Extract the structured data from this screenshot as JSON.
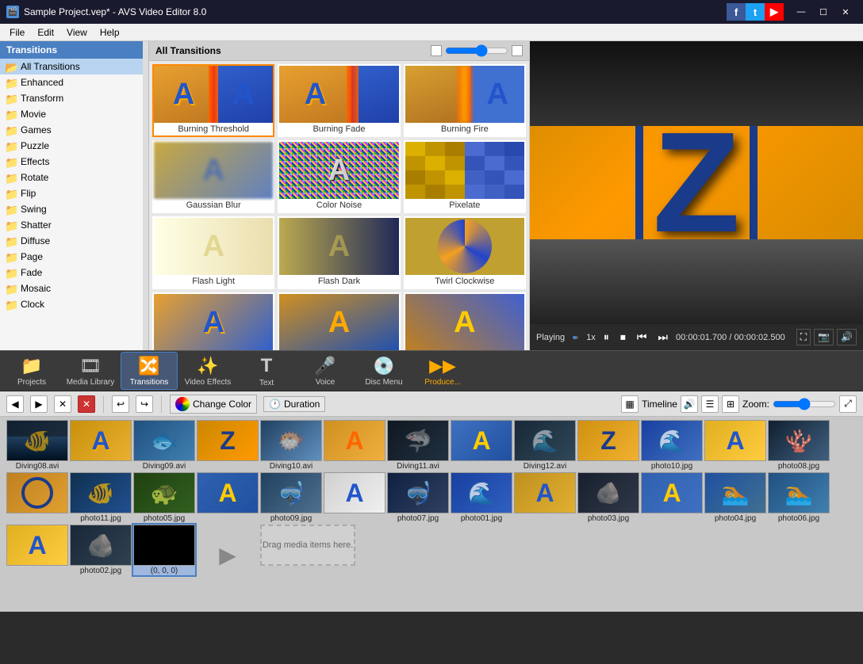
{
  "titleBar": {
    "title": "Sample Project.vep* - AVS Video Editor 8.0",
    "appIcon": "🎬",
    "controls": [
      "—",
      "☐",
      "✕"
    ]
  },
  "menuBar": {
    "items": [
      "File",
      "Edit",
      "View",
      "Help"
    ]
  },
  "transitionsPanel": {
    "header": "Transitions",
    "items": [
      {
        "label": "All Transitions",
        "active": true
      },
      {
        "label": "Enhanced"
      },
      {
        "label": "Transform"
      },
      {
        "label": "Movie"
      },
      {
        "label": "Games"
      },
      {
        "label": "Puzzle"
      },
      {
        "label": "Effects"
      },
      {
        "label": "Rotate"
      },
      {
        "label": "Flip"
      },
      {
        "label": "Swing"
      },
      {
        "label": "Shatter"
      },
      {
        "label": "Diffuse"
      },
      {
        "label": "Page"
      },
      {
        "label": "Fade"
      },
      {
        "label": "Mosaic"
      },
      {
        "label": "Clock"
      }
    ]
  },
  "gridPanel": {
    "header": "All Transitions",
    "thumbnails": [
      {
        "label": "Burning Threshold",
        "type": "burning-threshold"
      },
      {
        "label": "Burning Fade",
        "type": "burning-fade"
      },
      {
        "label": "Burning Fire",
        "type": "burning-fire"
      },
      {
        "label": "Gaussian Blur",
        "type": "gaussian-blur"
      },
      {
        "label": "Color Noise",
        "type": "color-noise"
      },
      {
        "label": "Pixelate",
        "type": "pixelate"
      },
      {
        "label": "Flash Light",
        "type": "flash-light"
      },
      {
        "label": "Flash Dark",
        "type": "flash-dark"
      },
      {
        "label": "Twirl Clockwise",
        "type": "twirl-clockwise"
      },
      {
        "label": "...",
        "type": "more1"
      },
      {
        "label": "...",
        "type": "more2"
      },
      {
        "label": "...",
        "type": "more3"
      }
    ]
  },
  "preview": {
    "status": "Playing",
    "speed": "1x",
    "currentTime": "00:00:01.700",
    "totalTime": "00:00:02.500",
    "progressPct": 68
  },
  "toolbar": {
    "items": [
      {
        "label": "Projects",
        "icon": "📁"
      },
      {
        "label": "Media Library",
        "icon": "🎞"
      },
      {
        "label": "Transitions",
        "icon": "🔀",
        "active": true
      },
      {
        "label": "Video Effects",
        "icon": "✨"
      },
      {
        "label": "Text",
        "icon": "T"
      },
      {
        "label": "Voice",
        "icon": "🎤"
      },
      {
        "label": "Disc Menu",
        "icon": "💿"
      },
      {
        "label": "Produce...",
        "icon": "▶"
      }
    ]
  },
  "timelineBar": {
    "changeColor": "Change Color",
    "duration": "Duration",
    "timeline": "Timeline",
    "zoom": "Zoom:"
  },
  "mediaItems": [
    {
      "label": "Diving08.avi",
      "type": "underwater-dark"
    },
    {
      "label": "",
      "type": "a-gold-thumb"
    },
    {
      "label": "Diving09.avi",
      "type": "underwater-light"
    },
    {
      "label": "",
      "type": "z-blue-thumb"
    },
    {
      "label": "Diving10.avi",
      "type": "coral-reef"
    },
    {
      "label": "",
      "type": "a-orange-thumb"
    },
    {
      "label": "Diving11.avi",
      "type": "dark-water"
    },
    {
      "label": "",
      "type": "a-blue-thumb"
    },
    {
      "label": "Diving12.avi",
      "type": "dark-scene"
    },
    {
      "label": "",
      "type": "z-gold-thumb"
    },
    {
      "label": "photo10.jpg",
      "type": "underwater-blue"
    },
    {
      "label": "",
      "type": "a-yellow-thumb"
    },
    {
      "label": "photo08.jpg",
      "type": "coral"
    },
    {
      "label": "",
      "type": "circle-gold"
    },
    {
      "label": "photo11.jpg",
      "type": "underwater2"
    },
    {
      "label": "photo05.jpg",
      "type": "green-scene"
    },
    {
      "label": "",
      "type": "a-blue2"
    },
    {
      "label": "photo09.jpg",
      "type": "diver"
    },
    {
      "label": "",
      "type": "a-white"
    },
    {
      "label": "photo07.jpg",
      "type": "diver2"
    },
    {
      "label": "photo01.jpg",
      "type": "underwater3"
    },
    {
      "label": "",
      "type": "a-gold2"
    },
    {
      "label": "photo03.jpg",
      "type": "seabed"
    },
    {
      "label": "",
      "type": "a-blue3"
    },
    {
      "label": "photo04.jpg",
      "type": "swimmer"
    },
    {
      "label": "photo06.jpg",
      "type": "swimmer2"
    },
    {
      "label": "",
      "type": "a-yellow2"
    },
    {
      "label": "photo02.jpg",
      "type": "rocks"
    },
    {
      "label": "(0, 0, 0)",
      "type": "black-thumb",
      "selected": true
    },
    {
      "label": "",
      "type": "arrow-right"
    },
    {
      "label": "Drag media items here.",
      "type": "drop-hint"
    }
  ]
}
